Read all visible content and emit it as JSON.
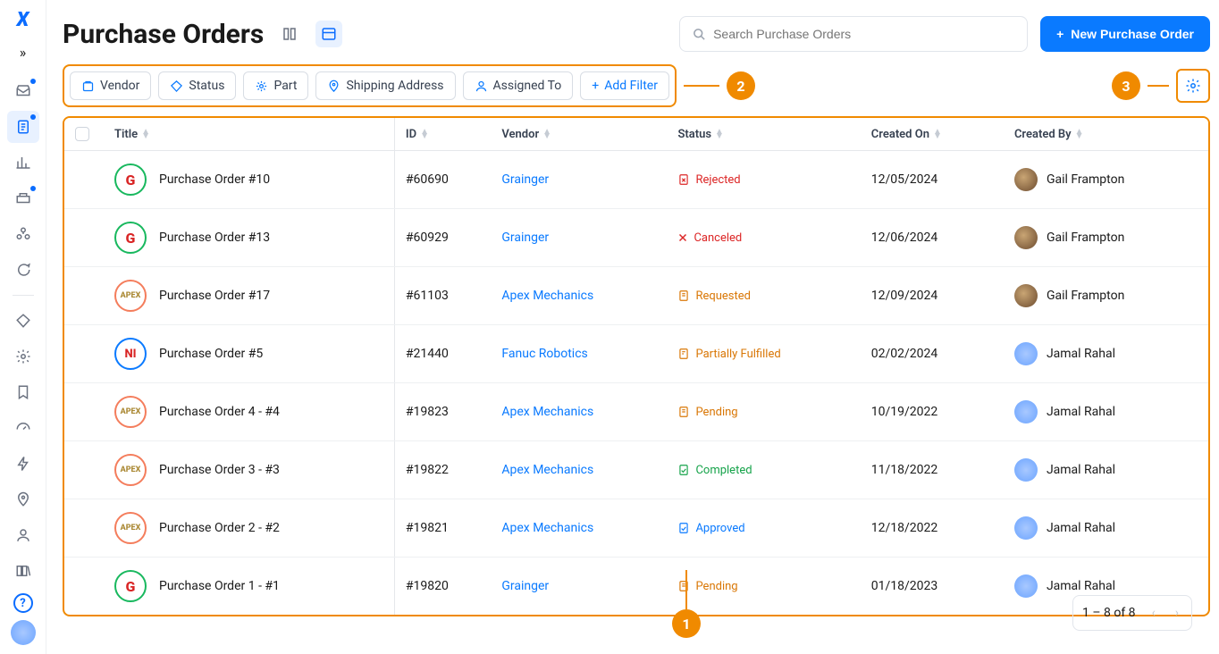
{
  "page": {
    "title": "Purchase Orders"
  },
  "search": {
    "placeholder": "Search Purchase Orders"
  },
  "new_button": {
    "label": "New Purchase Order"
  },
  "filters": {
    "vendor": "Vendor",
    "status": "Status",
    "part": "Part",
    "shipping": "Shipping Address",
    "assigned": "Assigned To",
    "add": "Add Filter"
  },
  "callouts": {
    "one": "1",
    "two": "2",
    "three": "3"
  },
  "columns": {
    "title": "Title",
    "id": "ID",
    "vendor": "Vendor",
    "status": "Status",
    "created_on": "Created On",
    "created_by": "Created By"
  },
  "rows": [
    {
      "title": "Purchase Order #10",
      "id": "#60690",
      "vendor": "Grainger",
      "status_key": "rejected",
      "status_label": "Rejected",
      "created_on": "12/05/2024",
      "created_by": "Gail Frampton",
      "logo": "g",
      "avatar": "g"
    },
    {
      "title": "Purchase Order #13",
      "id": "#60929",
      "vendor": "Grainger",
      "status_key": "canceled",
      "status_label": "Canceled",
      "created_on": "12/06/2024",
      "created_by": "Gail Frampton",
      "logo": "g",
      "avatar": "g"
    },
    {
      "title": "Purchase Order #17",
      "id": "#61103",
      "vendor": "Apex Mechanics",
      "status_key": "requested",
      "status_label": "Requested",
      "created_on": "12/09/2024",
      "created_by": "Gail Frampton",
      "logo": "a",
      "avatar": "g"
    },
    {
      "title": "Purchase Order #5",
      "id": "#21440",
      "vendor": "Fanuc Robotics",
      "status_key": "partial",
      "status_label": "Partially Fulfilled",
      "created_on": "02/02/2024",
      "created_by": "Jamal Rahal",
      "logo": "n",
      "avatar": "j"
    },
    {
      "title": "Purchase Order 4 - #4",
      "id": "#19823",
      "vendor": "Apex Mechanics",
      "status_key": "pending",
      "status_label": "Pending",
      "created_on": "10/19/2022",
      "created_by": "Jamal Rahal",
      "logo": "a",
      "avatar": "j"
    },
    {
      "title": "Purchase Order 3 - #3",
      "id": "#19822",
      "vendor": "Apex Mechanics",
      "status_key": "completed",
      "status_label": "Completed",
      "created_on": "11/18/2022",
      "created_by": "Jamal Rahal",
      "logo": "a",
      "avatar": "j"
    },
    {
      "title": "Purchase Order 2 - #2",
      "id": "#19821",
      "vendor": "Apex Mechanics",
      "status_key": "approved",
      "status_label": "Approved",
      "created_on": "12/18/2022",
      "created_by": "Jamal Rahal",
      "logo": "a",
      "avatar": "j"
    },
    {
      "title": "Purchase Order 1 - #1",
      "id": "#19820",
      "vendor": "Grainger",
      "status_key": "pending",
      "status_label": "Pending",
      "created_on": "01/18/2023",
      "created_by": "Jamal Rahal",
      "logo": "g",
      "avatar": "j"
    }
  ],
  "pager": {
    "text": "1 – 8 of 8"
  },
  "status_icons": {
    "rejected": "⎘",
    "canceled": "✕",
    "requested": "⎘",
    "partial": "⎘",
    "pending": "⎘",
    "completed": "⎘",
    "approved": "⎘"
  },
  "logo_text": {
    "g": "G",
    "a": "APEX",
    "n": "NI"
  }
}
